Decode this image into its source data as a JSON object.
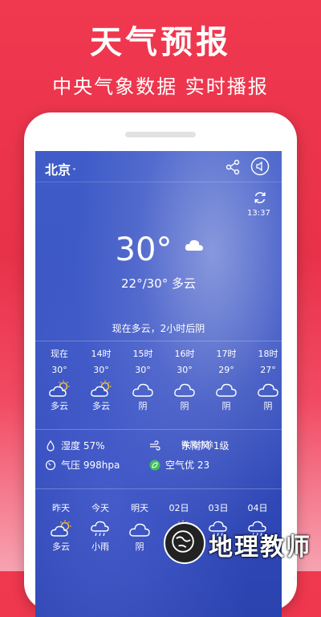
{
  "promo": {
    "title": "天气预报",
    "subtitle": "中央气象数据  实时播报"
  },
  "header": {
    "city": "北京",
    "chevron": "˅",
    "icons": [
      "share-icon",
      "sound-icon"
    ]
  },
  "current": {
    "updated_time": "13:37",
    "temperature": "30°",
    "range_condition": "22°/30° 多云",
    "forecast_text": "现在多云，2小时后阴"
  },
  "hourly": [
    {
      "label": "现在",
      "temp": "30°",
      "cond": "多云",
      "icon": "partly-cloudy"
    },
    {
      "label": "14时",
      "temp": "30°",
      "cond": "多云",
      "icon": "partly-cloudy"
    },
    {
      "label": "15时",
      "temp": "30°",
      "cond": "阴",
      "icon": "cloudy"
    },
    {
      "label": "16时",
      "temp": "30°",
      "cond": "阴",
      "icon": "cloudy"
    },
    {
      "label": "17时",
      "temp": "29°",
      "cond": "阴",
      "icon": "cloudy"
    },
    {
      "label": "18时",
      "temp": "27°",
      "cond": "阴",
      "icon": "cloudy"
    }
  ],
  "details": {
    "humidity": "湿度 57%",
    "wind": "东南风 1级",
    "wind_desc": "微风徐徐",
    "pressure": "气压 998hpa",
    "air": "空气优 23"
  },
  "daily": [
    {
      "label": "昨天",
      "cond": "多云",
      "icon": "partly-cloudy"
    },
    {
      "label": "今天",
      "cond": "小雨",
      "icon": "rain"
    },
    {
      "label": "明天",
      "cond": "阴",
      "icon": "cloudy"
    },
    {
      "label": "02日",
      "cond": "",
      "icon": "partly-cloudy"
    },
    {
      "label": "03日",
      "cond": "",
      "icon": "rain"
    },
    {
      "label": "04日",
      "cond": "",
      "icon": "rain"
    }
  ],
  "watermark": {
    "text": "地理教师"
  },
  "colors": {
    "background": "#e8324a",
    "screen": "#3a55c2",
    "sun": "#f5c542",
    "air_good": "#3fbf5a"
  }
}
